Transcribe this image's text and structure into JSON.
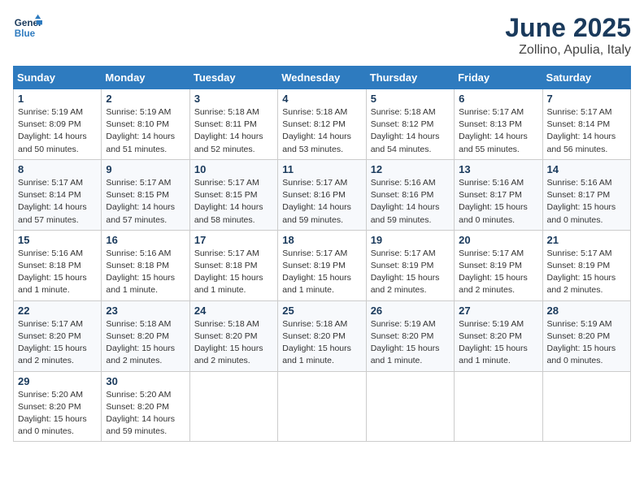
{
  "header": {
    "logo_general": "General",
    "logo_blue": "Blue",
    "month_title": "June 2025",
    "location": "Zollino, Apulia, Italy"
  },
  "weekdays": [
    "Sunday",
    "Monday",
    "Tuesday",
    "Wednesday",
    "Thursday",
    "Friday",
    "Saturday"
  ],
  "weeks": [
    [
      {
        "day": "1",
        "info": "Sunrise: 5:19 AM\nSunset: 8:09 PM\nDaylight: 14 hours\nand 50 minutes."
      },
      {
        "day": "2",
        "info": "Sunrise: 5:19 AM\nSunset: 8:10 PM\nDaylight: 14 hours\nand 51 minutes."
      },
      {
        "day": "3",
        "info": "Sunrise: 5:18 AM\nSunset: 8:11 PM\nDaylight: 14 hours\nand 52 minutes."
      },
      {
        "day": "4",
        "info": "Sunrise: 5:18 AM\nSunset: 8:12 PM\nDaylight: 14 hours\nand 53 minutes."
      },
      {
        "day": "5",
        "info": "Sunrise: 5:18 AM\nSunset: 8:12 PM\nDaylight: 14 hours\nand 54 minutes."
      },
      {
        "day": "6",
        "info": "Sunrise: 5:17 AM\nSunset: 8:13 PM\nDaylight: 14 hours\nand 55 minutes."
      },
      {
        "day": "7",
        "info": "Sunrise: 5:17 AM\nSunset: 8:14 PM\nDaylight: 14 hours\nand 56 minutes."
      }
    ],
    [
      {
        "day": "8",
        "info": "Sunrise: 5:17 AM\nSunset: 8:14 PM\nDaylight: 14 hours\nand 57 minutes."
      },
      {
        "day": "9",
        "info": "Sunrise: 5:17 AM\nSunset: 8:15 PM\nDaylight: 14 hours\nand 57 minutes."
      },
      {
        "day": "10",
        "info": "Sunrise: 5:17 AM\nSunset: 8:15 PM\nDaylight: 14 hours\nand 58 minutes."
      },
      {
        "day": "11",
        "info": "Sunrise: 5:17 AM\nSunset: 8:16 PM\nDaylight: 14 hours\nand 59 minutes."
      },
      {
        "day": "12",
        "info": "Sunrise: 5:16 AM\nSunset: 8:16 PM\nDaylight: 14 hours\nand 59 minutes."
      },
      {
        "day": "13",
        "info": "Sunrise: 5:16 AM\nSunset: 8:17 PM\nDaylight: 15 hours\nand 0 minutes."
      },
      {
        "day": "14",
        "info": "Sunrise: 5:16 AM\nSunset: 8:17 PM\nDaylight: 15 hours\nand 0 minutes."
      }
    ],
    [
      {
        "day": "15",
        "info": "Sunrise: 5:16 AM\nSunset: 8:18 PM\nDaylight: 15 hours\nand 1 minute."
      },
      {
        "day": "16",
        "info": "Sunrise: 5:16 AM\nSunset: 8:18 PM\nDaylight: 15 hours\nand 1 minute."
      },
      {
        "day": "17",
        "info": "Sunrise: 5:17 AM\nSunset: 8:18 PM\nDaylight: 15 hours\nand 1 minute."
      },
      {
        "day": "18",
        "info": "Sunrise: 5:17 AM\nSunset: 8:19 PM\nDaylight: 15 hours\nand 1 minute."
      },
      {
        "day": "19",
        "info": "Sunrise: 5:17 AM\nSunset: 8:19 PM\nDaylight: 15 hours\nand 2 minutes."
      },
      {
        "day": "20",
        "info": "Sunrise: 5:17 AM\nSunset: 8:19 PM\nDaylight: 15 hours\nand 2 minutes."
      },
      {
        "day": "21",
        "info": "Sunrise: 5:17 AM\nSunset: 8:19 PM\nDaylight: 15 hours\nand 2 minutes."
      }
    ],
    [
      {
        "day": "22",
        "info": "Sunrise: 5:17 AM\nSunset: 8:20 PM\nDaylight: 15 hours\nand 2 minutes."
      },
      {
        "day": "23",
        "info": "Sunrise: 5:18 AM\nSunset: 8:20 PM\nDaylight: 15 hours\nand 2 minutes."
      },
      {
        "day": "24",
        "info": "Sunrise: 5:18 AM\nSunset: 8:20 PM\nDaylight: 15 hours\nand 2 minutes."
      },
      {
        "day": "25",
        "info": "Sunrise: 5:18 AM\nSunset: 8:20 PM\nDaylight: 15 hours\nand 1 minute."
      },
      {
        "day": "26",
        "info": "Sunrise: 5:19 AM\nSunset: 8:20 PM\nDaylight: 15 hours\nand 1 minute."
      },
      {
        "day": "27",
        "info": "Sunrise: 5:19 AM\nSunset: 8:20 PM\nDaylight: 15 hours\nand 1 minute."
      },
      {
        "day": "28",
        "info": "Sunrise: 5:19 AM\nSunset: 8:20 PM\nDaylight: 15 hours\nand 0 minutes."
      }
    ],
    [
      {
        "day": "29",
        "info": "Sunrise: 5:20 AM\nSunset: 8:20 PM\nDaylight: 15 hours\nand 0 minutes."
      },
      {
        "day": "30",
        "info": "Sunrise: 5:20 AM\nSunset: 8:20 PM\nDaylight: 14 hours\nand 59 minutes."
      },
      {
        "day": "",
        "info": ""
      },
      {
        "day": "",
        "info": ""
      },
      {
        "day": "",
        "info": ""
      },
      {
        "day": "",
        "info": ""
      },
      {
        "day": "",
        "info": ""
      }
    ]
  ]
}
